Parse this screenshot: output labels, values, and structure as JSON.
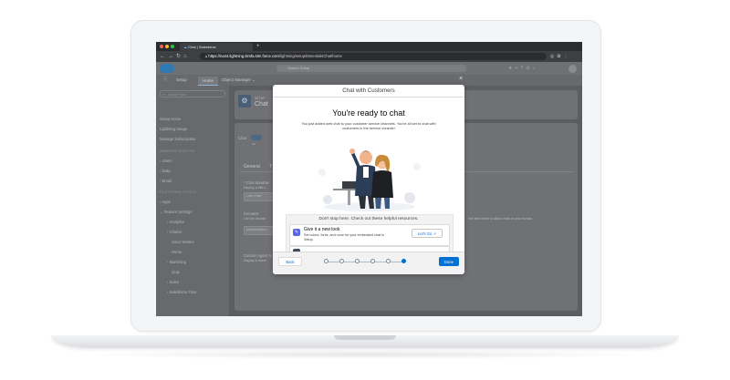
{
  "browser": {
    "tab_title": "Chat | Salesforce",
    "new_tab": "+",
    "url_prefix": "https://",
    "url_host": "na44.lightning.stmfa.stm.force.com",
    "url_path": "/lightning/setup/EssentialsChat/home"
  },
  "header": {
    "search_placeholder": "Search Setup"
  },
  "nav": {
    "app_name": "Setup",
    "home_tab": "Home",
    "object_manager_tab": "Object Manager"
  },
  "sidebar": {
    "quick_find": "Quick Find",
    "items_top": [
      "Setup Home",
      "Lightning Usage",
      "Manage Subscription"
    ],
    "section_admin": "ADMINISTRATION",
    "admin_items": [
      "Users",
      "Data",
      "Email"
    ],
    "section_platform": "PLATFORM TOOLS",
    "platform_items": [
      "Apps",
      "Feature Settings",
      "Analytics",
      "Chatter",
      "Cisco Webex",
      "Home",
      "Marketing",
      "Quip",
      "Sales",
      "Salesforce Files"
    ]
  },
  "main": {
    "setup_label": "SETUP",
    "page_title": "Chat",
    "chat_toggle_label": "Chat",
    "chat_toggle_state": "On",
    "tab_general": "General",
    "tab_t": "T",
    "chat_window_label": "* Chat Window",
    "chat_window_desc": "Display a title o",
    "chat_window_value": "Live Chat",
    "domains_label": "Domains",
    "domains_desc": "List the domain",
    "domains_right_text": "this field blank to allow chats on any domain.",
    "domains_value": "yourdomain.c",
    "custom_agent_label": "Custom Agent N",
    "custom_agent_desc": "Display a name"
  },
  "modal": {
    "header": "Chat with Customers",
    "close": "×",
    "title": "You're ready to chat",
    "description": "You just added web chat to your customer service channels. You're all set to chat with customers in the service console!",
    "resources_title": "Don't stop here. Check out these helpful resources.",
    "resource1_title": "Give it a new look",
    "resource1_desc": "Set colors, fonts, and more for your embedded chat in Setup.",
    "resource1_button": "Let's Go",
    "back_button": "Back",
    "done_button": "Done",
    "steps_total": 6,
    "active_step": 6
  },
  "colors": {
    "accent": "#0070d2",
    "laptop": "#f4f5f7"
  }
}
